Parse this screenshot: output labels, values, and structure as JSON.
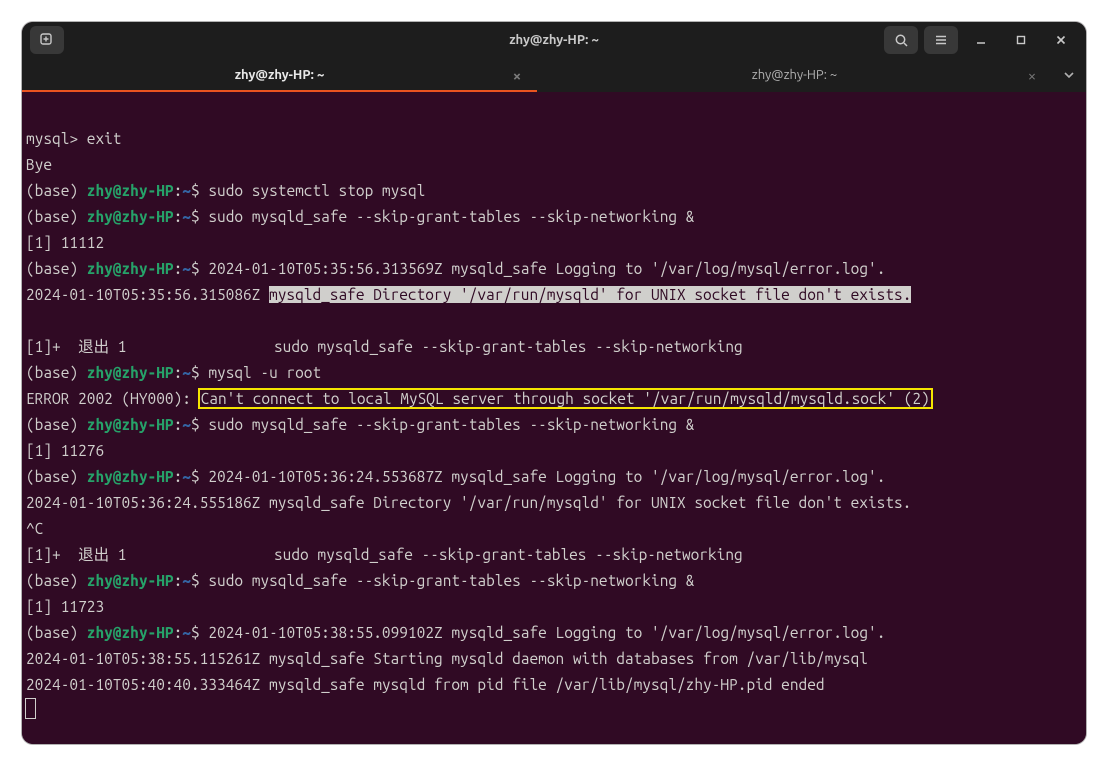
{
  "title": "zhy@zhy-HP: ~",
  "tabs": [
    {
      "label": "zhy@zhy-HP: ~",
      "active": true
    },
    {
      "label": "zhy@zhy-HP: ~",
      "active": false
    }
  ],
  "prompt": {
    "base": "(base) ",
    "userhost": "zhy@zhy-HP",
    "sep": ":",
    "cwd": "~",
    "dollar": "$ "
  },
  "lines": {
    "blank": "",
    "l01": "mysql> exit",
    "l02": "Bye",
    "cmd1": "sudo systemctl stop mysql",
    "cmd2": "sudo mysqld_safe --skip-grant-tables --skip-networking &",
    "l05": "[1] 11112",
    "cmd3a": "2024-01-10T05:35:56.313569Z mysqld_safe Logging to '/var/log/mysql/error.log'.",
    "l07a": "2024-01-10T05:35:56.315086Z ",
    "l07sel": "mysqld_safe Directory '/var/run/mysqld' for UNIX socket file don't exists.",
    "l09": "[1]+  退出 1                 sudo mysqld_safe --skip-grant-tables --skip-networking",
    "cmd4": "mysql -u root",
    "l11a": "ERROR 2002 (HY000): ",
    "l11hl": "Can't connect to local MySQL server through socket '/var/run/mysqld/mysqld.sock' (2)",
    "cmd5": "sudo mysqld_safe --skip-grant-tables --skip-networking &",
    "l13": "[1] 11276",
    "cmd6a": "2024-01-10T05:36:24.553687Z mysqld_safe Logging to '/var/log/mysql/error.log'.",
    "l15": "2024-01-10T05:36:24.555186Z mysqld_safe Directory '/var/run/mysqld' for UNIX socket file don't exists.",
    "l16": "^C",
    "l17": "[1]+  退出 1                 sudo mysqld_safe --skip-grant-tables --skip-networking",
    "cmd7": "sudo mysqld_safe --skip-grant-tables --skip-networking &",
    "l19": "[1] 11723",
    "cmd8a": "2024-01-10T05:38:55.099102Z mysqld_safe Logging to '/var/log/mysql/error.log'.",
    "l21": "2024-01-10T05:38:55.115261Z mysqld_safe Starting mysqld daemon with databases from /var/lib/mysql",
    "l22": "2024-01-10T05:40:40.333464Z mysqld_safe mysqld from pid file /var/lib/mysql/zhy-HP.pid ended"
  }
}
